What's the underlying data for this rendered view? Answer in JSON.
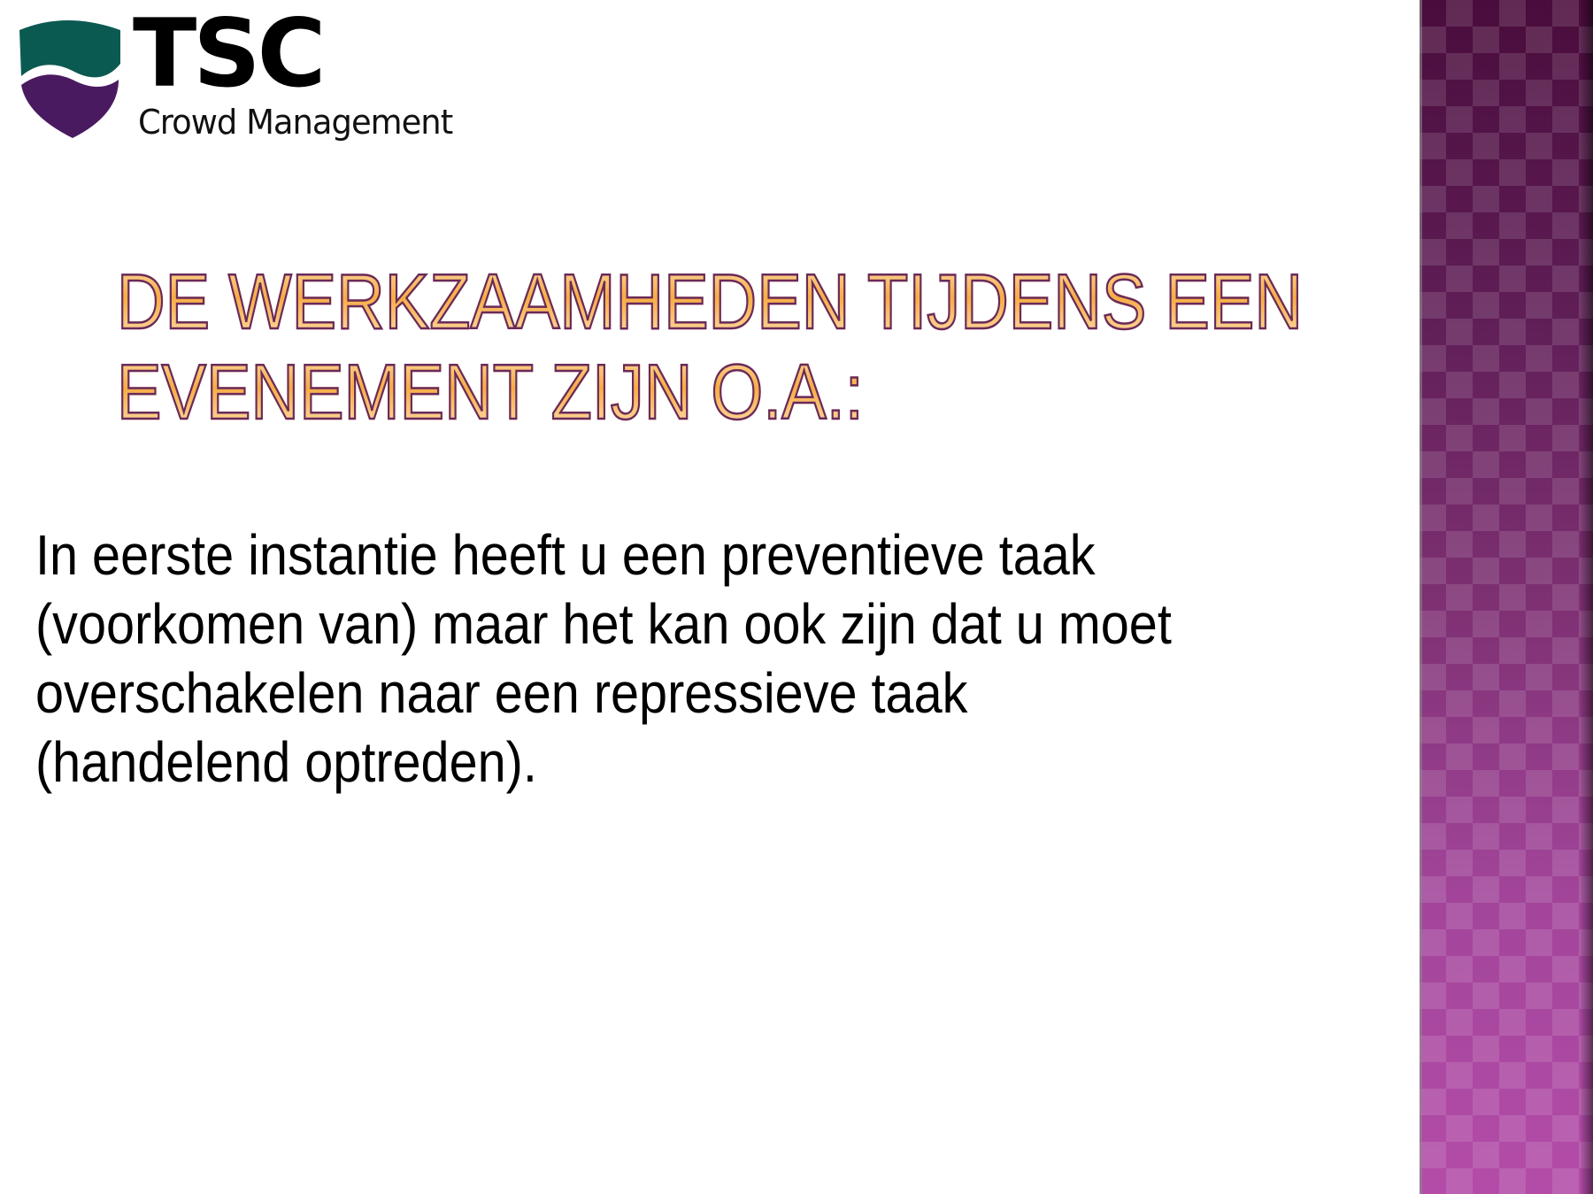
{
  "logo": {
    "name": "TSC",
    "subtitle": "Crowd Management",
    "colors": {
      "teal": "#0b5a52",
      "purple": "#4a1a60"
    }
  },
  "slide": {
    "title_lines": [
      "DE WERKZAAMHEDEN TIJDENS EEN",
      "EVENEMENT ZIJN O.A.:"
    ],
    "body_lines": [
      "In eerste instantie heeft u een preventieve taak",
      "(voorkomen van) maar het kan ook zijn dat u moet",
      "overschakelen naar een repressieve taak",
      "(handelend optreden)."
    ]
  },
  "colors": {
    "title_fill": "#f6ad45",
    "title_outline": "#6a2a5a",
    "sidebar_top": "#4a0c3c",
    "sidebar_bottom": "#b34ca8"
  }
}
